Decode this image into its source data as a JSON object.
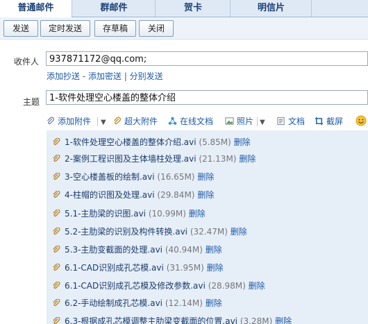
{
  "tabs": [
    "普通邮件",
    "群邮件",
    "贺卡",
    "明信片"
  ],
  "toolbar": {
    "send": "发送",
    "timed_send": "定时发送",
    "save_draft": "存草稿",
    "close": "关闭"
  },
  "recipient": {
    "label": "收件人",
    "value": "937871172@qq.com;"
  },
  "links": {
    "add_cc": "添加抄送",
    "dash": " - ",
    "add_bcc": "添加密送",
    "bar": " | ",
    "separate_send": "分别发送"
  },
  "subject": {
    "label": "主题",
    "value": "1-软件处理空心楼盖的整体介绍"
  },
  "attach_toolbar": {
    "add_attachment": "添加附件",
    "large_attachment": "超大附件",
    "online_doc": "在线文档",
    "photo": "照片",
    "document": "文档",
    "screenshot": "截屏"
  },
  "files": [
    {
      "name": "1-软件处理空心楼盖的整体介绍.avi",
      "size": "(5.85M)",
      "delete": "删除"
    },
    {
      "name": "2-案例工程识图及主体墙柱处理.avi",
      "size": "(21.13M)",
      "delete": "删除"
    },
    {
      "name": "3-空心楼盖板的绘制.avi",
      "size": "(16.65M)",
      "delete": "删除"
    },
    {
      "name": "4-柱帽的识图及处理.avi",
      "size": "(29.84M)",
      "delete": "删除"
    },
    {
      "name": "5.1-主肋梁的识图.avi",
      "size": "(10.99M)",
      "delete": "删除"
    },
    {
      "name": "5.2-主肋梁的识别及构件转换.avi",
      "size": "(32.47M)",
      "delete": "删除"
    },
    {
      "name": "5.3-主肋变截面的处理.avi",
      "size": "(40.94M)",
      "delete": "删除"
    },
    {
      "name": "6.1-CAD识别成孔芯模.avi",
      "size": "(31.95M)",
      "delete": "删除"
    },
    {
      "name": "6.1-CAD识别成孔芯模及修改参数.avi",
      "size": "(28.98M)",
      "delete": "删除"
    },
    {
      "name": "6.2-手动绘制成孔芯模.avi",
      "size": "(12.14M)",
      "delete": "删除"
    },
    {
      "name": "6.3-根据成孔芯模调整主肋梁变截面的位置.avi",
      "size": "(3.28M)",
      "delete": "删除"
    }
  ],
  "colors": {
    "link": "#1e5aa8",
    "tab_text": "#1b3f73",
    "file_bg": "#e6eef8"
  }
}
